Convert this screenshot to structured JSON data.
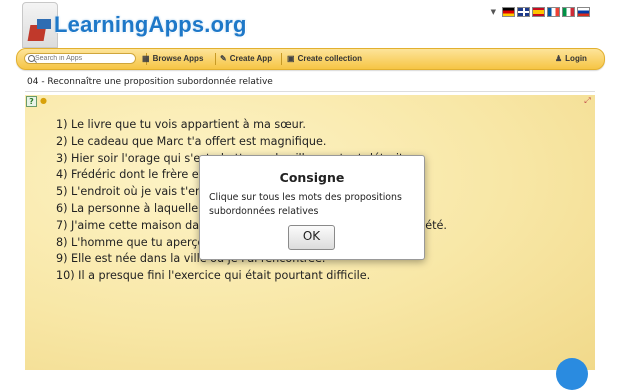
{
  "header": {
    "logo_text": "LearningApps.org",
    "flags": [
      "de",
      "gb",
      "es",
      "fr",
      "it",
      "ru"
    ]
  },
  "nav": {
    "search_placeholder": "Search in Apps",
    "browse": "Browse Apps",
    "create": "Create App",
    "collection": "Create collection",
    "login": "Login"
  },
  "page": {
    "title": "04 - Reconnaître une proposition subordonnée relative"
  },
  "exercise": {
    "sentences": [
      "1) Le livre que tu vois appartient à ma sœur.",
      "2) Le cadeau que Marc t'a offert est magnifique.",
      "3) Hier soir l'orage qui s'est abattu sur le village a tout détruit.",
      "4) Frédéric dont le frère est mon meilleur ami a quatorze un as.",
      "5) L'endroit où je vais t'emmener est magique.",
      "6) La personne à laquelle je pense est absente.",
      "7) J'aime cette maison dans laquelle je vis quand je suis au frais l'été.",
      "8) L'homme que tu aperçois là-bas fait sa loterie à pied.",
      "9) Elle est née dans la ville où je l'ai rencontrée.",
      "10) Il a presque fini l'exercice qui était pourtant difficile."
    ]
  },
  "dialog": {
    "title": "Consigne",
    "text": "Clique sur tous les mots des propositions subordonnées relatives",
    "ok": "OK"
  }
}
